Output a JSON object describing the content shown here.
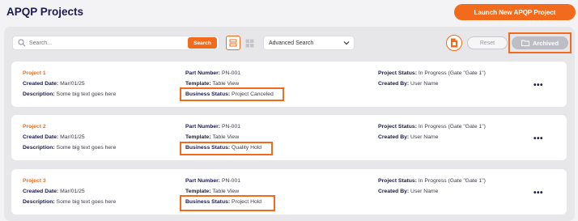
{
  "header": {
    "title": "APQP Projects",
    "launch_label": "Launch New APQP Project"
  },
  "toolbar": {
    "search_placeholder": "Search...",
    "search_button": "Search",
    "advanced_search": "Advanced Search",
    "reset_label": "Reset",
    "archived_label": "Archived"
  },
  "labels": {
    "created_date": "Created Date:",
    "description": "Description:",
    "part_number": "Part Number:",
    "template": "Template:",
    "business_status": "Business Status:",
    "project_status": "Project Status:",
    "created_by": "Created By:"
  },
  "projects": [
    {
      "name": "Project 1",
      "created_date": "Mar/01/25",
      "description": "Some big text goes here",
      "part_number": "PN-001",
      "template": "Table View",
      "business_status": "Project Canceled",
      "project_status": "In Progress (Gate \"Gate 1\")",
      "created_by": "User Name"
    },
    {
      "name": "Project 2",
      "created_date": "Mar/01/25",
      "description": "Some big text goes here",
      "part_number": "PN-001",
      "template": "Table View",
      "business_status": "Quality Hold",
      "project_status": "In Progress (Gate \"Gate 1\")",
      "created_by": "User Name"
    },
    {
      "name": "Project 3",
      "created_date": "Mar/01/25",
      "description": "Some big text goes here",
      "part_number": "PN-001",
      "template": "Table View",
      "business_status": "Project Hold",
      "project_status": "In Progress (Gate \"Gate 1\")",
      "created_by": "User Name"
    }
  ],
  "more_glyph": "•••",
  "colors": {
    "accent": "#f26b1d",
    "title": "#1b1b4d",
    "panel": "#e7e7ea"
  }
}
